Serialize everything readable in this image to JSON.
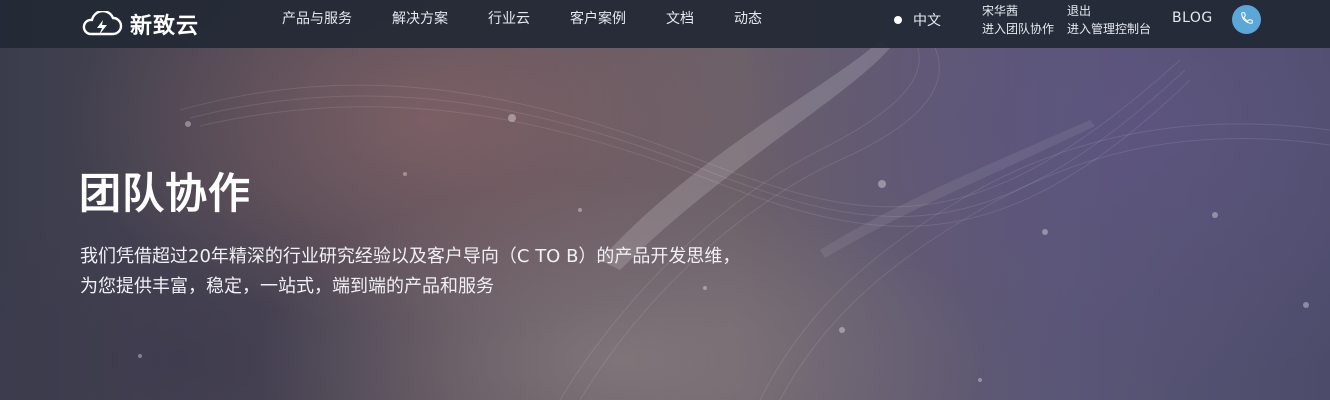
{
  "brand": {
    "name": "新致云",
    "logo_icon": "cloud-bolt-icon"
  },
  "nav": {
    "items": [
      {
        "label": "产品与服务"
      },
      {
        "label": "解决方案"
      },
      {
        "label": "行业云"
      },
      {
        "label": "客户案例"
      },
      {
        "label": "文档"
      },
      {
        "label": "动态"
      }
    ]
  },
  "header": {
    "language": "中文",
    "user_name": "宋华茜",
    "team_link": "进入团队协作",
    "logout": "退出",
    "console_link": "进入管理控制台",
    "blog": "BLOG",
    "phone_icon": "phone-icon",
    "phone_color": "#5aa7d8"
  },
  "hero": {
    "title": "团队协作",
    "desc_line1": "我们凭借超过20年精深的行业研究经验以及客户导向（C TO B）的产品开发思维，",
    "desc_line2": "为您提供丰富，稳定，一站式，端到端的产品和服务"
  }
}
